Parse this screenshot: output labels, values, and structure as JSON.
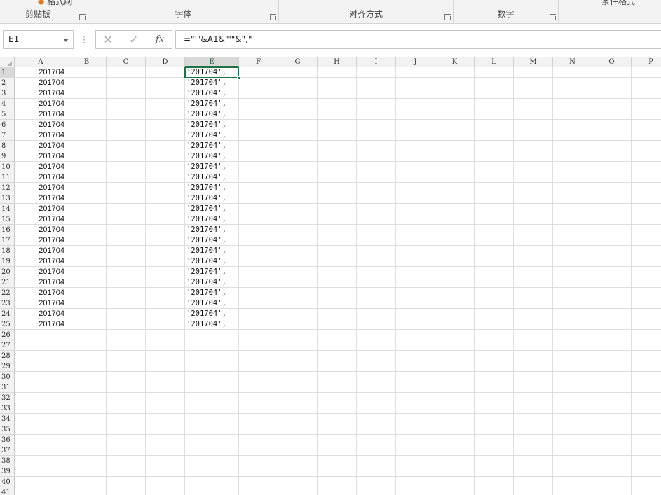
{
  "ribbon": {
    "groups": [
      {
        "label": "剪贴板"
      },
      {
        "label": "字体"
      },
      {
        "label": "对齐方式"
      },
      {
        "label": "数字"
      }
    ],
    "format_painter_label": "格式刷",
    "cut_off_label": "条件格式"
  },
  "formula_bar": {
    "name_box": "E1",
    "cancel_symbol": "✕",
    "enter_symbol": "✓",
    "fx_symbol": "fx",
    "formula": "=\"'\"&A1&\"'\"&\",\""
  },
  "columns": [
    "A",
    "B",
    "C",
    "D",
    "E",
    "F",
    "G",
    "H",
    "I",
    "J",
    "K",
    "L",
    "M",
    "N",
    "O",
    "P"
  ],
  "selected_column": "E",
  "row_numbers": [
    "1",
    "2",
    "3",
    "4",
    "5",
    "6",
    "7",
    "8",
    "9",
    "10",
    "11",
    "12",
    "13",
    "14",
    "15",
    "16",
    "17",
    "18",
    "19",
    "20",
    "21",
    "22",
    "23",
    "24",
    "25",
    "26",
    "27",
    "28",
    "29",
    "30",
    "31",
    "32",
    "33",
    "34",
    "35",
    "36",
    "37",
    "38",
    "39",
    "40",
    "41"
  ],
  "selected_row": "1",
  "column_A": [
    "201704",
    "201704",
    "201704",
    "201704",
    "201704",
    "201704",
    "201704",
    "201704",
    "201704",
    "201704",
    "201704",
    "201704",
    "201704",
    "201704",
    "201704",
    "201704",
    "201704",
    "201704",
    "201704",
    "201704",
    "201704",
    "201704",
    "201704",
    "201704",
    "201704"
  ],
  "column_E": [
    "'201704',",
    "'201704',",
    "'201704',",
    "'201704',",
    "'201704',",
    "'201704',",
    "'201704',",
    "'201704',",
    "'201704',",
    "'201704',",
    "'201704',",
    "'201704',",
    "'201704',",
    "'201704',",
    "'201704',",
    "'201704',",
    "'201704',",
    "'201704',",
    "'201704',",
    "'201704',",
    "'201704',",
    "'201704',",
    "'201704',",
    "'201704',",
    "'201704',"
  ],
  "active_cell": "E1",
  "colors": {
    "selection_green": "#217346",
    "header_bg": "#f2f2f2",
    "gridline": "#dedede"
  }
}
